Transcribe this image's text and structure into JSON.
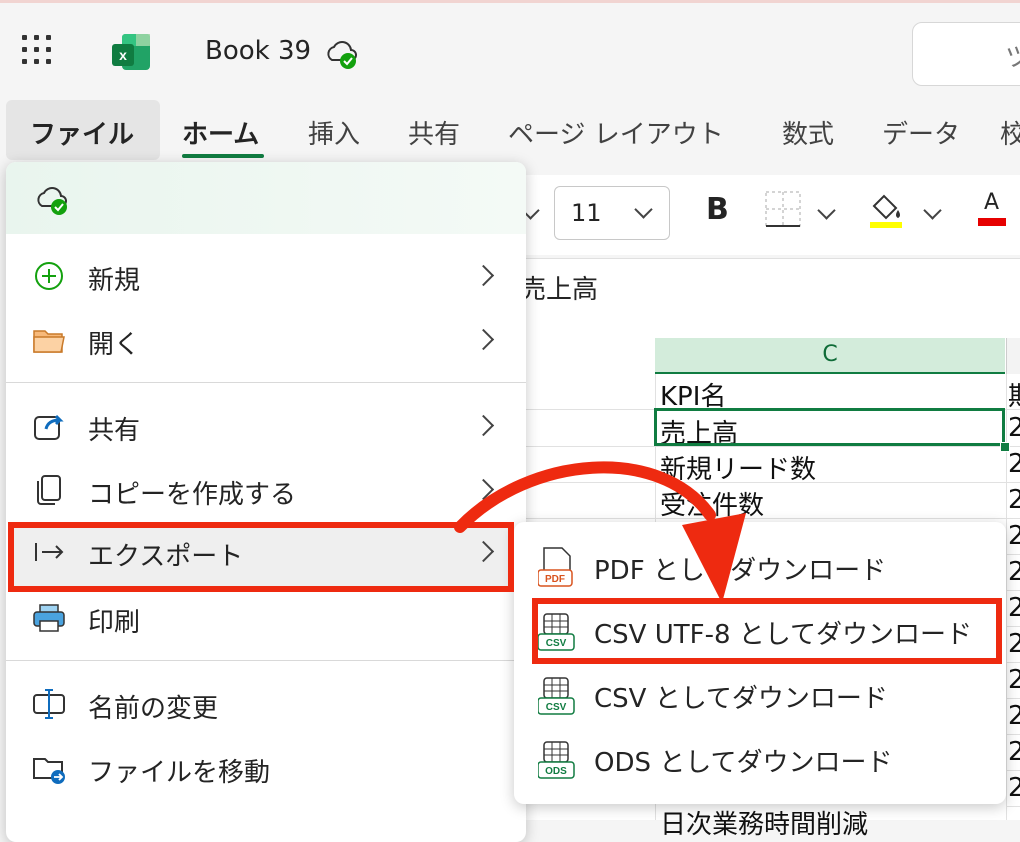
{
  "window": {
    "doc_title": "Book 39",
    "search_text": "ツ"
  },
  "ribbon_tabs": [
    {
      "label": "ファイル"
    },
    {
      "label": "ホーム"
    },
    {
      "label": "挿入"
    },
    {
      "label": "共有"
    },
    {
      "label": "ページ レイアウト"
    },
    {
      "label": "数式"
    },
    {
      "label": "データ"
    },
    {
      "label": "校"
    }
  ],
  "toolbar": {
    "font_size": "11",
    "bold_label": "B",
    "font_color_label": "A"
  },
  "formula_bar": {
    "value": "売上高"
  },
  "sheet": {
    "column_header": "C",
    "cells": [
      "KPI名",
      "売上高",
      "新規リード数",
      "受注件数",
      "日次業務時間削減"
    ],
    "right_col_values": [
      "期",
      "2",
      "2",
      "2",
      "2",
      "2",
      "2",
      "2",
      "2",
      "2",
      "2",
      "2"
    ]
  },
  "file_menu": {
    "items": [
      {
        "label": "新規",
        "icon": "plus-circle-icon"
      },
      {
        "label": "開く",
        "icon": "folder-icon"
      },
      {
        "label": "共有",
        "icon": "share-icon"
      },
      {
        "label": "コピーを作成する",
        "icon": "copy-icon"
      },
      {
        "label": "エクスポート",
        "icon": "export-icon"
      },
      {
        "label": "印刷",
        "icon": "printer-icon"
      },
      {
        "label": "名前の変更",
        "icon": "rename-icon"
      },
      {
        "label": "ファイルを移動",
        "icon": "move-file-icon"
      }
    ]
  },
  "export_submenu": {
    "items": [
      {
        "label": "PDF としてダウンロード",
        "badge": "PDF"
      },
      {
        "label": "CSV UTF-8 としてダウンロード",
        "badge": "CSV"
      },
      {
        "label": "CSV としてダウンロード",
        "badge": "CSV"
      },
      {
        "label": "ODS としてダウンロード",
        "badge": "ODS"
      }
    ]
  },
  "colors": {
    "accent": "#107c41",
    "annotation": "#ee2a10"
  }
}
